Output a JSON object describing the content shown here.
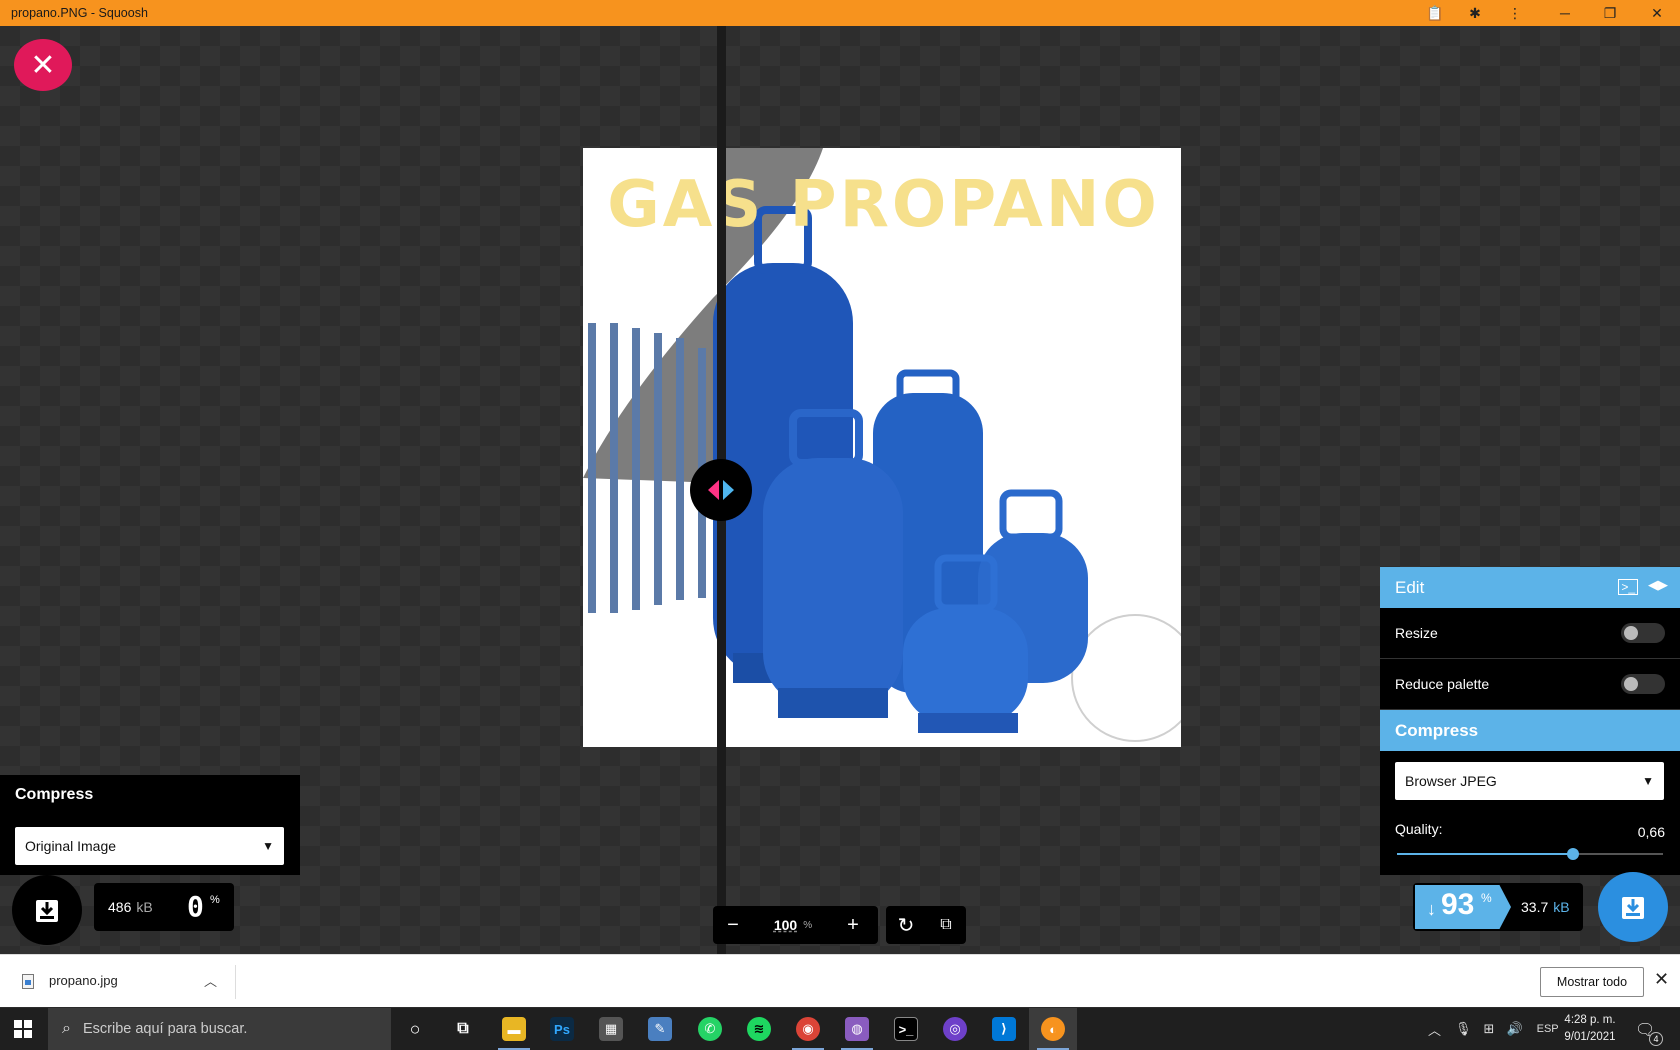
{
  "window": {
    "title": "propano.PNG - Squoosh",
    "controls": [
      "clipboard-icon",
      "puzzle-icon",
      "more-vert-icon",
      "minimize-icon",
      "restore-icon",
      "close-icon"
    ]
  },
  "image": {
    "headline": "GAS PROPANO"
  },
  "left_panel": {
    "header": "Compress",
    "select_value": "Original Image",
    "size_value": "486",
    "size_unit": "kB",
    "percent": "0",
    "percent_sign": "%"
  },
  "zoom": {
    "value": "100",
    "unit": "%"
  },
  "right_panel": {
    "edit_header": "Edit",
    "resize_label": "Resize",
    "resize_on": false,
    "palette_label": "Reduce palette",
    "palette_on": false,
    "compress_header": "Compress",
    "select_value": "Browser JPEG",
    "quality_label": "Quality:",
    "quality_value": "0,66",
    "quality_fraction": 0.66,
    "accent_color": "#5cb3e8"
  },
  "result": {
    "arrow": "↓",
    "savings": "93",
    "percent_sign": "%",
    "size_value": "33.7",
    "size_unit": "kB"
  },
  "downloads": {
    "file_name": "propano.jpg",
    "show_all": "Mostrar todo"
  },
  "taskbar": {
    "search_placeholder": "Escribe aquí para buscar.",
    "language": "ESP",
    "time": "4:28 p. m.",
    "date": "9/01/2021",
    "notification_count": "4"
  }
}
